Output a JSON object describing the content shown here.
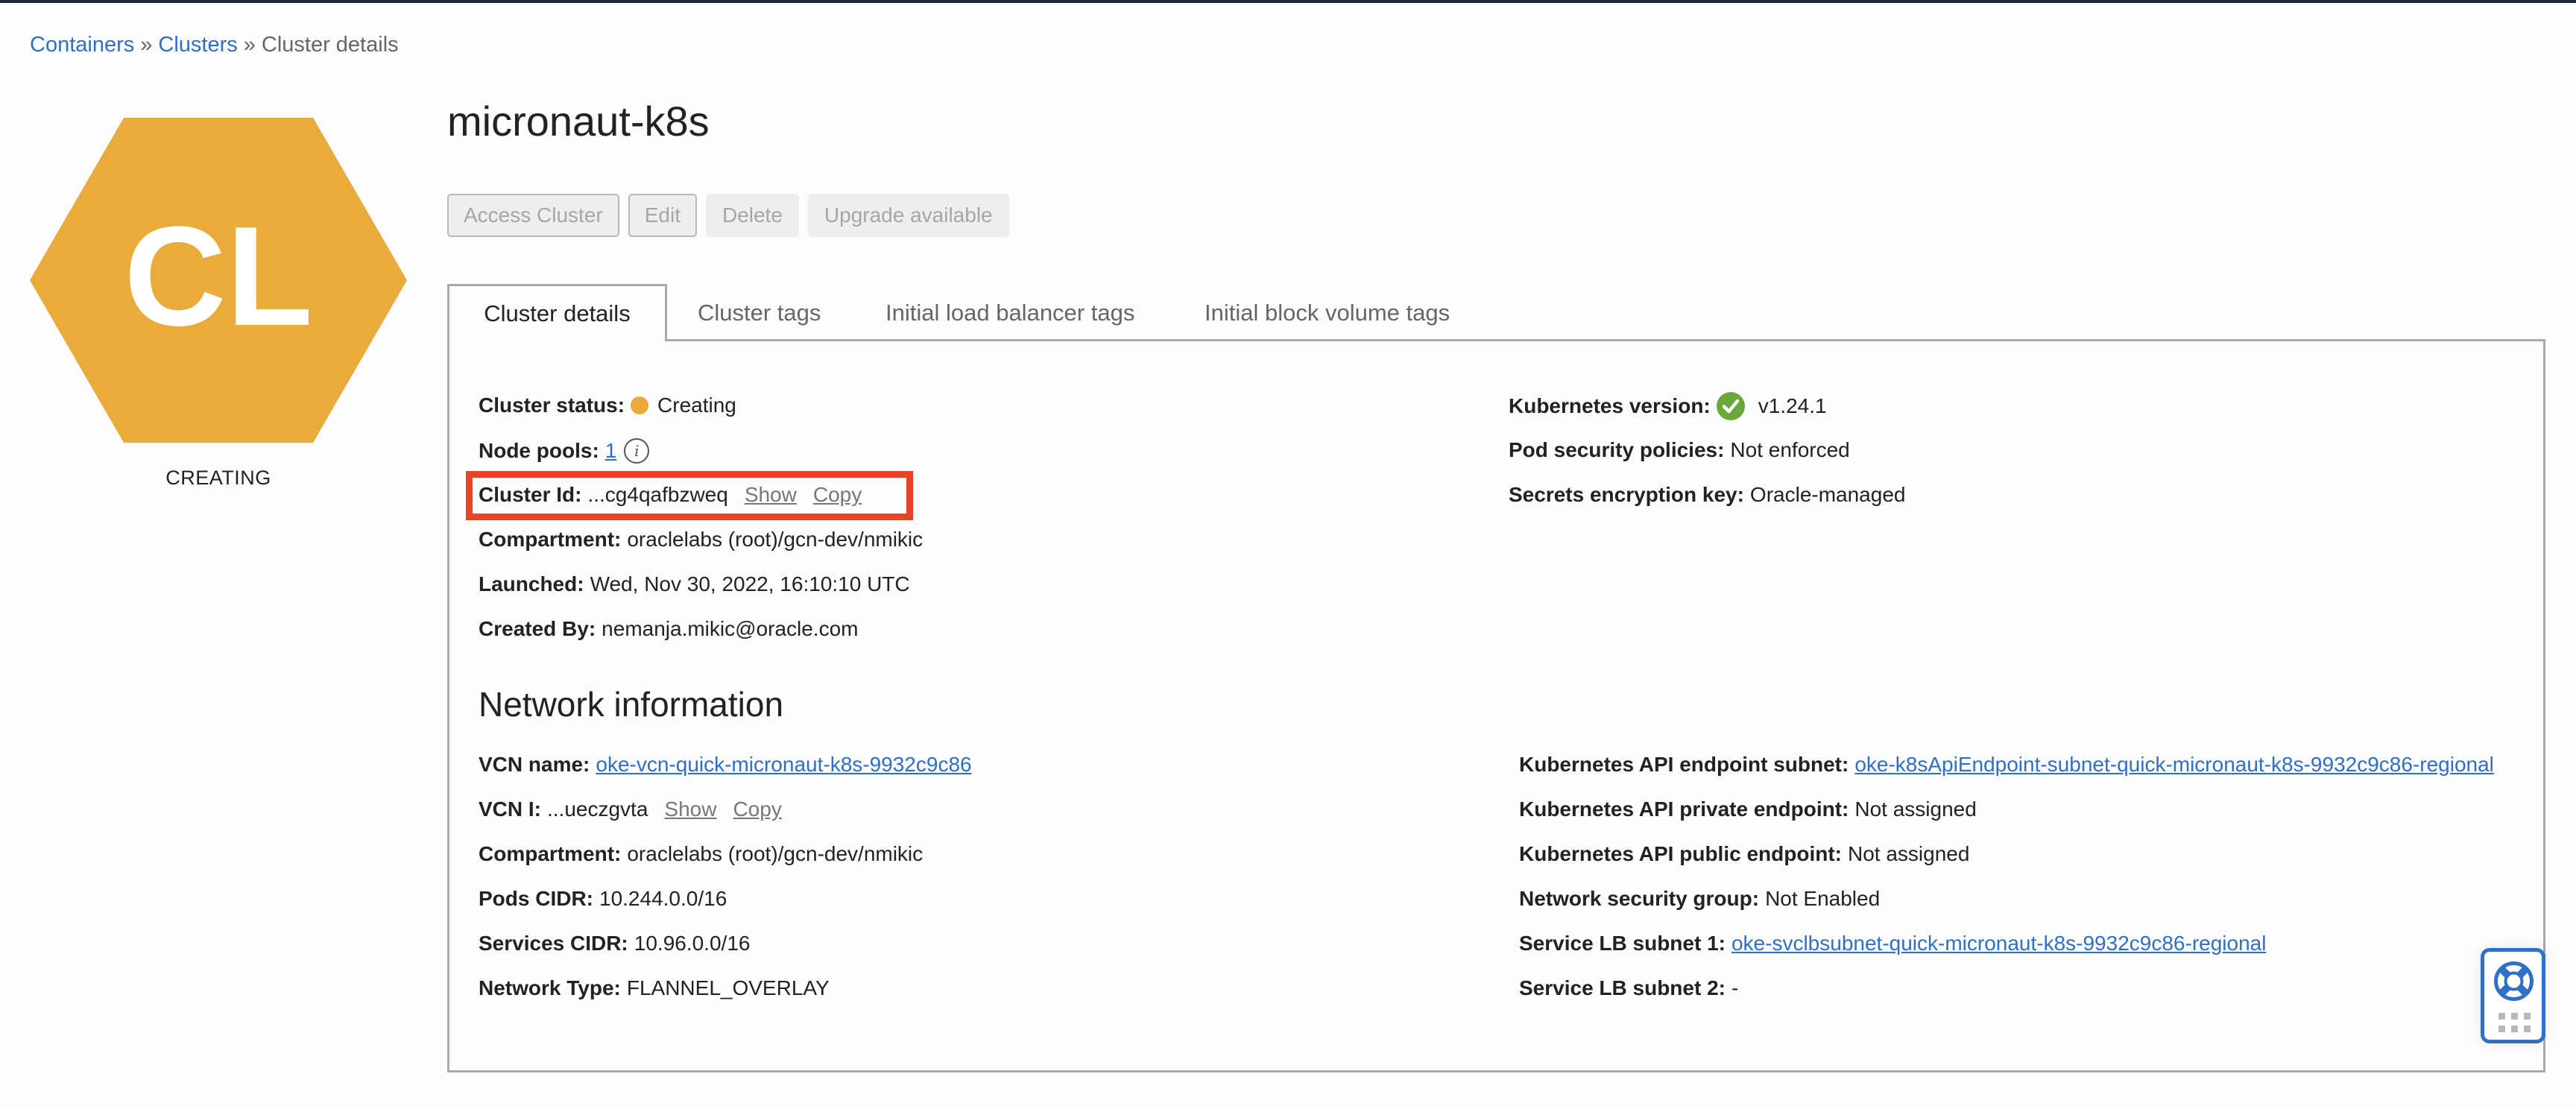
{
  "breadcrumb": {
    "items": [
      "Containers",
      "Clusters"
    ],
    "current": "Cluster details",
    "separator": "»"
  },
  "badge": {
    "initials": "CL",
    "status": "CREATING",
    "color": "#e9ab3b"
  },
  "header": {
    "title": "micronaut-k8s"
  },
  "actions": {
    "access_cluster": "Access Cluster",
    "edit": "Edit",
    "delete": "Delete",
    "upgrade": "Upgrade available"
  },
  "tabs": [
    {
      "label": "Cluster details",
      "active": true
    },
    {
      "label": "Cluster tags",
      "active": false
    },
    {
      "label": "Initial load balancer tags",
      "active": false
    },
    {
      "label": "Initial block volume tags",
      "active": false
    }
  ],
  "cluster_details": {
    "left": {
      "status": {
        "label": "Cluster status:",
        "value": "Creating",
        "color": "#e9a93b"
      },
      "node_pools": {
        "label": "Node pools:",
        "value": "1",
        "info_icon": "info-icon"
      },
      "cluster_id": {
        "label": "Cluster Id:",
        "value": "...cg4qafbzweq",
        "show": "Show",
        "copy": "Copy"
      },
      "compartment": {
        "label": "Compartment:",
        "value": "oraclelabs (root)/gcn-dev/nmikic"
      },
      "launched": {
        "label": "Launched:",
        "value": "Wed, Nov 30, 2022, 16:10:10 UTC"
      },
      "created_by": {
        "label": "Created By:",
        "value": "nemanja.mikic@oracle.com"
      }
    },
    "right": {
      "k8s_version": {
        "label": "Kubernetes version:",
        "value": "v1.24.1",
        "status_color": "#6aa83b"
      },
      "pod_security": {
        "label": "Pod security policies:",
        "value": "Not enforced"
      },
      "secrets_key": {
        "label": "Secrets encryption key:",
        "value": "Oracle-managed"
      }
    }
  },
  "network": {
    "title": "Network information",
    "left": {
      "vcn_name": {
        "label": "VCN name:",
        "value": "oke-vcn-quick-micronaut-k8s-9932c9c86"
      },
      "vcn_id": {
        "label": "VCN I:",
        "value": "...ueczgvta",
        "show": "Show",
        "copy": "Copy"
      },
      "compartment": {
        "label": "Compartment:",
        "value": "oraclelabs (root)/gcn-dev/nmikic"
      },
      "pods_cidr": {
        "label": "Pods CIDR:",
        "value": "10.244.0.0/16"
      },
      "services_cidr": {
        "label": "Services CIDR:",
        "value": "10.96.0.0/16"
      },
      "network_type": {
        "label": "Network Type:",
        "value": "FLANNEL_OVERLAY"
      }
    },
    "right": {
      "api_endpoint_subnet": {
        "label": "Kubernetes API endpoint subnet:",
        "value": "oke-k8sApiEndpoint-subnet-quick-micronaut-k8s-9932c9c86-regional"
      },
      "api_private_endpoint": {
        "label": "Kubernetes API private endpoint:",
        "value": "Not assigned"
      },
      "api_public_endpoint": {
        "label": "Kubernetes API public endpoint:",
        "value": "Not assigned"
      },
      "nsg": {
        "label": "Network security group:",
        "value": "Not Enabled"
      },
      "lb_subnet_1": {
        "label": "Service LB subnet 1:",
        "value": "oke-svclbsubnet-quick-micronaut-k8s-9932c9c86-regional"
      },
      "lb_subnet_2": {
        "label": "Service LB subnet 2:",
        "value": "-"
      }
    }
  },
  "help_widget": {
    "icon": "lifebuoy-icon",
    "secondary_icon": "apps-grid-icon"
  },
  "colors": {
    "link": "#2f6fc7",
    "highlight": "#e8432a",
    "border": "#aaaaaa"
  }
}
